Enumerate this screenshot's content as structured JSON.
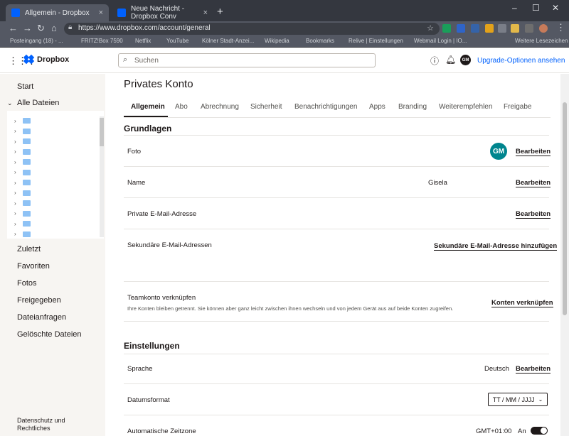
{
  "browser": {
    "tabs": [
      {
        "title": "Allgemein - Dropbox",
        "active": true
      },
      {
        "title": "Neue Nachricht - Dropbox Conv",
        "active": false
      }
    ],
    "new_tab": "+",
    "close_glyph": "×",
    "window_controls": [
      "–",
      "☐",
      "✕"
    ],
    "url": "https://www.dropbox.com/account/general",
    "bookmarks": [
      "Posteingang (18) - ...",
      "FRITZ!Box 7590",
      "Netflix",
      "YouTube",
      "Kölner Stadt-Anzei...",
      "Wikipedia",
      "Bookmarks",
      "Relive | Einstellungen",
      "Webmail Login | IO...",
      "Weitere Lesezeichen"
    ]
  },
  "header": {
    "brand": "Dropbox",
    "search_placeholder": "Suchen",
    "avatar_initials": "GM",
    "upgrade": "Upgrade-Optionen ansehen"
  },
  "sidebar": {
    "start": "Start",
    "all_files": "Alle Dateien",
    "tree_rows": 12,
    "items": [
      "Zuletzt",
      "Favoriten",
      "Fotos",
      "Freigegeben",
      "Dateianfragen",
      "Gelöschte Dateien"
    ],
    "footer": "Datenschutz und Rechtliches"
  },
  "main": {
    "title": "Privates Konto",
    "tabs": [
      "Allgemein",
      "Abo",
      "Abrechnung",
      "Sicherheit",
      "Benachrichtigungen",
      "Apps",
      "Branding",
      "Weiterempfehlen",
      "Freigabe"
    ],
    "sections": {
      "basics": "Grundlagen",
      "settings": "Einstellungen"
    },
    "rows": {
      "photo": {
        "label": "Foto",
        "initials": "GM",
        "action": "Bearbeiten"
      },
      "name": {
        "label": "Name",
        "value": "Gisela",
        "action": "Bearbeiten"
      },
      "email": {
        "label": "Private E-Mail-Adresse",
        "action": "Bearbeiten"
      },
      "secondary": {
        "label": "Sekundäre E-Mail-Adressen",
        "action": "Sekundäre E-Mail-Adresse hinzufügen"
      },
      "team": {
        "label": "Teamkonto verknüpfen",
        "sub": "Ihre Konten bleiben getrennt. Sie können aber ganz leicht zwischen ihnen wechseln und von jedem Gerät aus auf beide Konten zugreifen.",
        "action": "Konten verknüpfen"
      },
      "language": {
        "label": "Sprache",
        "value": "Deutsch",
        "action": "Bearbeiten"
      },
      "date_format": {
        "label": "Datumsformat",
        "value": "TT / MM / JJJJ"
      },
      "timezone": {
        "label": "Automatische Zeitzone",
        "value": "GMT+01:00",
        "toggle_label": "An",
        "toggle_on": true
      }
    }
  },
  "colors": {
    "accent": "#0061fe",
    "avatar": "#00858e",
    "text": "#1e1919"
  }
}
